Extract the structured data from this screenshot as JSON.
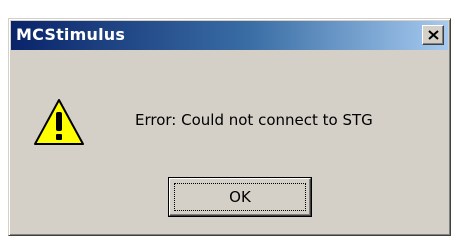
{
  "dialog": {
    "title": "MCStimulus",
    "message": "Error: Could not connect to STG",
    "icon": "warning-icon",
    "ok_label": "OK",
    "close_icon": "close-icon"
  },
  "colors": {
    "titlebar_start": "#0a246a",
    "titlebar_end": "#a6caf0",
    "dialog_face": "#d4d0c8",
    "warning_yellow": "#ffff00"
  }
}
